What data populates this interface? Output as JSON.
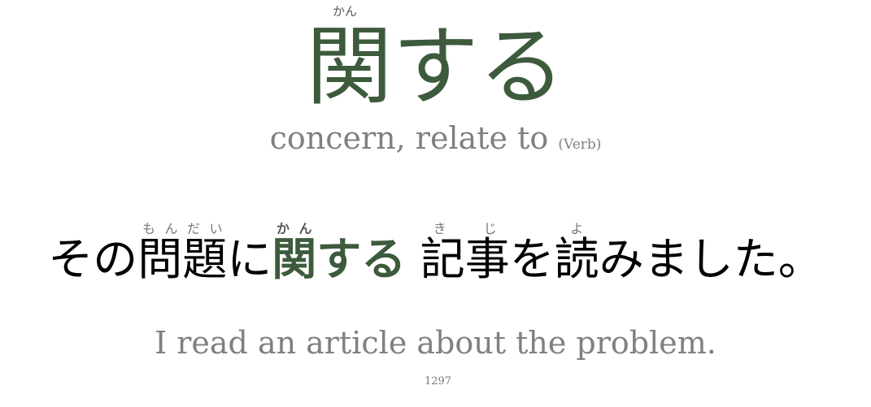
{
  "headword": {
    "reading": "かん",
    "kanji": "関",
    "kana": "する",
    "color": "#3d5a3d"
  },
  "meaning": {
    "gloss": "concern, relate to",
    "part_of_speech": "(Verb)"
  },
  "sentence": {
    "seg1": "その",
    "seg2_base": "問題",
    "seg2_reading": "もんだい",
    "seg3": "に",
    "seg4_base": "関",
    "seg4_reading": "かん",
    "seg5": "する",
    "seg6_base": "記事",
    "seg6_reading": "きじ",
    "seg7": "を",
    "seg8_base": "読",
    "seg8_reading": "よ",
    "seg9": "みました。"
  },
  "translation": "I read an article about the problem.",
  "card_number": "1297"
}
